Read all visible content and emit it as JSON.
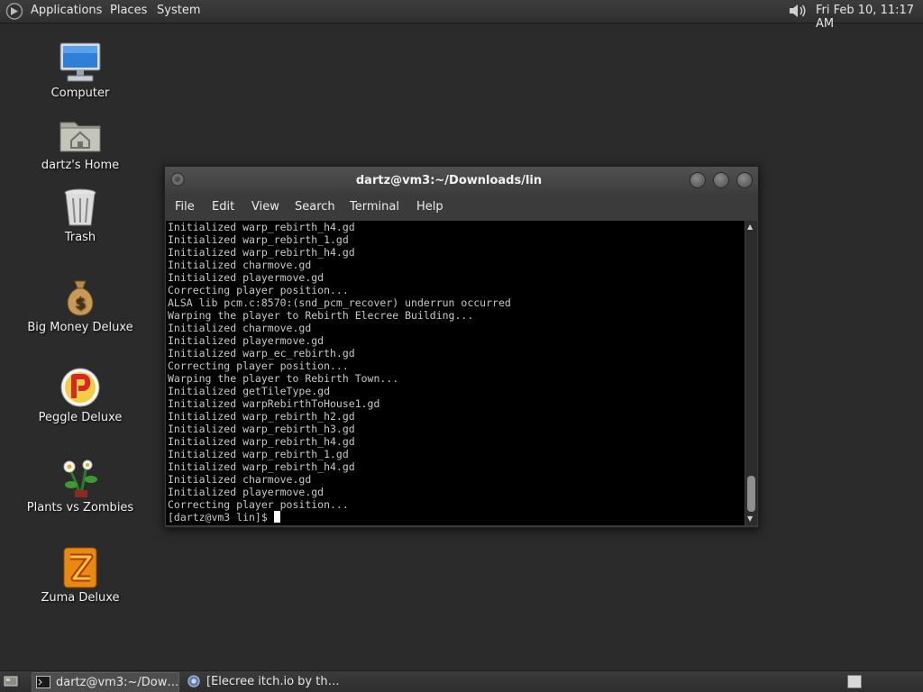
{
  "top_panel": {
    "menus": [
      "Applications",
      "Places",
      "System"
    ],
    "clock": "Fri Feb 10, 11:17 AM",
    "volume_icon": "speaker-icon"
  },
  "desktop_icons": [
    {
      "label": "Computer",
      "icon": "computer-icon"
    },
    {
      "label": "dartz's Home",
      "icon": "home-folder-icon"
    },
    {
      "label": "Trash",
      "icon": "trash-icon"
    },
    {
      "label": "Big Money Deluxe",
      "icon": "money-bag-icon"
    },
    {
      "label": "Peggle Deluxe",
      "icon": "peggle-icon"
    },
    {
      "label": "Plants vs Zombies",
      "icon": "plants-vs-zombies-icon"
    },
    {
      "label": "Zuma Deluxe",
      "icon": "zuma-icon"
    }
  ],
  "terminal": {
    "title": "dartz@vm3:~/Downloads/lin",
    "menu": [
      "File",
      "Edit",
      "View",
      "Search",
      "Terminal",
      "Help"
    ],
    "lines": [
      "Initialized warp_rebirth_h4.gd",
      "Initialized warp_rebirth_1.gd",
      "Initialized warp_rebirth_h4.gd",
      "Initialized charmove.gd",
      "Initialized playermove.gd",
      "Correcting player position...",
      "ALSA lib pcm.c:8570:(snd_pcm_recover) underrun occurred",
      "Warping the player to Rebirth Elecree Building...",
      "Initialized charmove.gd",
      "Initialized playermove.gd",
      "Initialized warp_ec_rebirth.gd",
      "Correcting player position...",
      "Warping the player to Rebirth Town...",
      "Initialized getTileType.gd",
      "Initialized warpRebirthToHouse1.gd",
      "Initialized warp_rebirth_h2.gd",
      "Initialized warp_rebirth_h3.gd",
      "Initialized warp_rebirth_h4.gd",
      "Initialized warp_rebirth_1.gd",
      "Initialized warp_rebirth_h4.gd",
      "Initialized charmove.gd",
      "Initialized playermove.gd",
      "Correcting player position..."
    ],
    "prompt": "[dartz@vm3 lin]$ "
  },
  "taskbar": {
    "tasks": [
      {
        "label": "dartz@vm3:~/Dow…",
        "icon": "terminal-icon",
        "active": true
      },
      {
        "label": "[Elecree itch.io by th…",
        "icon": "browser-icon",
        "active": false
      }
    ]
  },
  "colors": {
    "desktop": "#2a2b2a",
    "terminal_bg": "#000000",
    "terminal_fg": "#c8c8c8"
  }
}
